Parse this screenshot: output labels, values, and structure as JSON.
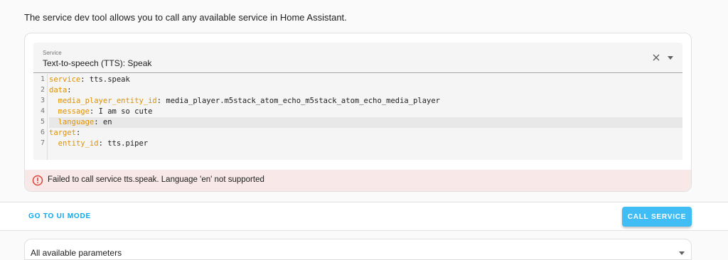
{
  "intro_text": "The service dev tool allows you to call any available service in Home Assistant.",
  "service_select": {
    "label": "Service",
    "value": "Text-to-speech (TTS): Speak",
    "clear_icon": "close-icon",
    "dropdown_icon": "arrow-drop-down-icon"
  },
  "editor": {
    "line_numbers": [
      "1",
      "2",
      "3",
      "4",
      "5",
      "6",
      "7"
    ],
    "lines": [
      {
        "key": "service",
        "value": " tts.speak",
        "indent": ""
      },
      {
        "key": "data",
        "value": "",
        "indent": ""
      },
      {
        "key": "media_player_entity_id",
        "value": " media_player.m5stack_atom_echo_m5stack_atom_echo_media_player",
        "indent": "  "
      },
      {
        "key": "message",
        "value": " I am so cute",
        "indent": "  "
      },
      {
        "key": "language",
        "value": " en",
        "indent": "  "
      },
      {
        "key": "target",
        "value": "",
        "indent": ""
      },
      {
        "key": "entity_id",
        "value": " tts.piper",
        "indent": "  "
      }
    ]
  },
  "error": {
    "icon": "alert-circle-icon",
    "message": "Failed to call service tts.speak. Language 'en' not supported"
  },
  "footer": {
    "ui_mode_label": "GO TO UI MODE",
    "call_service_label": "CALL SERVICE"
  },
  "params": {
    "label": "All available parameters"
  },
  "colors": {
    "accent": "#03a9f4",
    "button": "#41bdf5",
    "key": "#e09100",
    "error_bg": "#f8e8e8",
    "error_icon": "#db4437"
  }
}
